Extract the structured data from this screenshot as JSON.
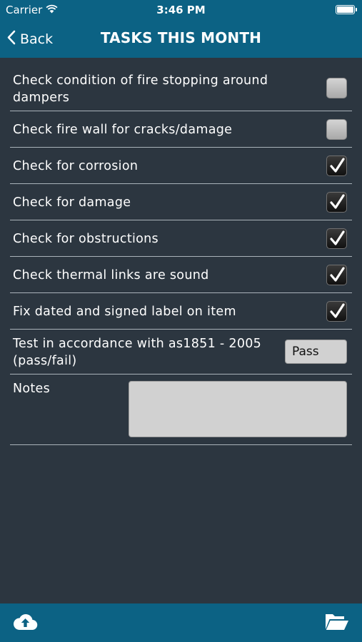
{
  "status_bar": {
    "carrier": "Carrier",
    "time": "3:46 PM"
  },
  "nav": {
    "back_label": "Back",
    "title": "TASKS THIS MONTH"
  },
  "tasks": [
    {
      "label_line1": "Check condition of fire stopping around",
      "label_line2": "dampers",
      "checked": false
    },
    {
      "label": "Check fire wall for cracks/damage",
      "checked": false
    },
    {
      "label": "Check for corrosion",
      "checked": true
    },
    {
      "label": "Check for damage",
      "checked": true
    },
    {
      "label": "Check for obstructions",
      "checked": true
    },
    {
      "label": "Check thermal links are sound",
      "checked": true
    },
    {
      "label": "Fix dated and signed label on item",
      "checked": true
    }
  ],
  "test": {
    "label_line1": "Test in accordance with as1851 - 2005",
    "label_line2": "(pass/fail)",
    "value": "Pass"
  },
  "notes": {
    "label": "Notes",
    "value": ""
  },
  "toolbar": {
    "left_icon": "cloud-upload-icon",
    "right_icon": "open-folder-icon"
  },
  "colors": {
    "bar": "#0c6284",
    "background": "#2c3640",
    "divider": "#aab3ba"
  }
}
